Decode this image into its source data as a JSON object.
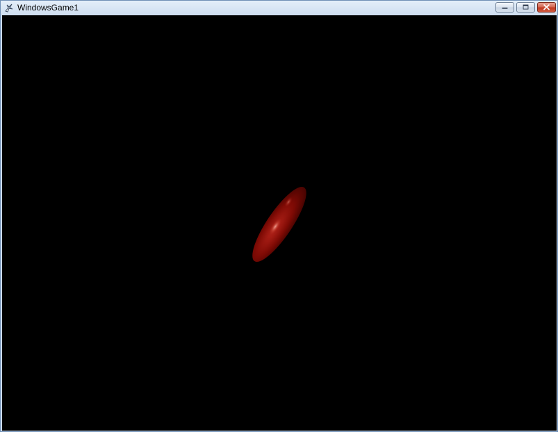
{
  "window": {
    "title": "WindowsGame1",
    "icon": "xna-game-icon"
  },
  "caption_buttons": {
    "minimize": "minimize-icon",
    "maximize": "maximize-icon",
    "close": "close-icon"
  },
  "scene": {
    "background_color": "#000000",
    "object": {
      "shape": "ellipsoid",
      "color": "#8a0b05",
      "highlight_color": "#e07a6a"
    }
  }
}
